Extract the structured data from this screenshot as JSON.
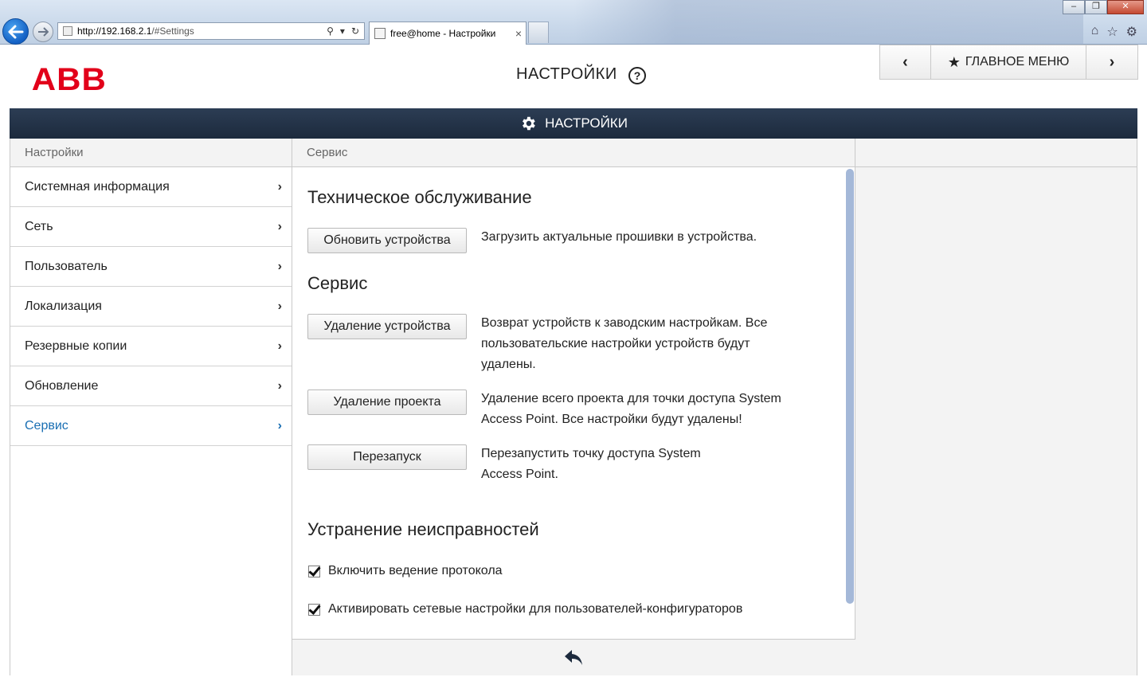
{
  "browser": {
    "url_host": "http://192.168.2.1",
    "url_path": "/#Settings",
    "tab_title": "free@home - Настройки",
    "tab_close": "×"
  },
  "header": {
    "logo": "ABB",
    "title": "НАСТРОЙКИ",
    "help": "?",
    "nav_prev": "‹",
    "nav_main": "ГЛАВНОЕ МЕНЮ",
    "nav_next": "›"
  },
  "section_bar": {
    "title": "НАСТРОЙКИ"
  },
  "left_panel": {
    "heading": "Настройки",
    "items": [
      {
        "label": "Системная информация"
      },
      {
        "label": "Сеть"
      },
      {
        "label": "Пользователь"
      },
      {
        "label": "Локализация"
      },
      {
        "label": "Резервные копии"
      },
      {
        "label": "Обновление"
      },
      {
        "label": "Сервис"
      }
    ],
    "active_item": "Сервис"
  },
  "mid_panel": {
    "heading": "Сервис",
    "maintenance": {
      "title": "Техническое обслуживание",
      "update_button": "Обновить устройства",
      "update_desc": "Загрузить актуальные прошивки в устройства."
    },
    "service": {
      "title": "Сервис",
      "remove_device_button": "Удаление устройства",
      "remove_device_desc": "Возврат устройств к заводским настройкам. Все пользовательские настройки устройств будут удалены.",
      "remove_project_button": "Удаление проекта",
      "remove_project_desc": "Удаление всего проекта для точки доступа System Access Point. Все настройки будут удалены!",
      "restart_button": "Перезапуск",
      "restart_desc": "Перезапустить точку доступа System Access Point."
    },
    "troubleshooting": {
      "title": "Устранение неисправностей",
      "logging_label": "Включить ведение протокола",
      "logging_checked": true,
      "network_label": "Активировать сетевые настройки для пользователей-конфигураторов",
      "network_checked": true
    }
  },
  "colors": {
    "brand_red": "#e2001a",
    "section_bar": "#1c2a3d",
    "active_link": "#1a6fb3"
  }
}
